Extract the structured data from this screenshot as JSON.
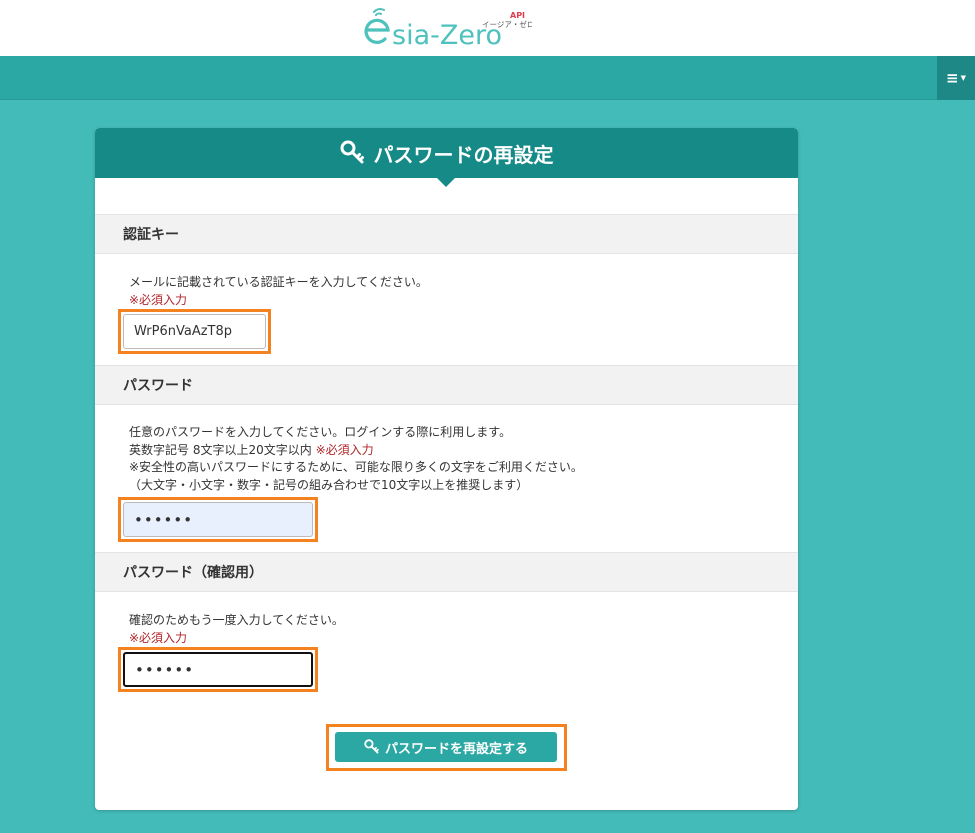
{
  "header": {
    "logo_text": "esia-Zero",
    "logo_api": "API",
    "logo_kana": "イージア・ゼロ",
    "menu_icon": "hamburger-icon"
  },
  "card": {
    "title": "パスワードの再設定",
    "title_icon": "key-icon"
  },
  "auth_key": {
    "heading": "認証キー",
    "description": "メールに記載されている認証キーを入力してください。",
    "required": "※必須入力",
    "value": "WrP6nVaAzT8p"
  },
  "password": {
    "heading": "パスワード",
    "line1": "任意のパスワードを入力してください。ログインする際に利用します。",
    "line2": "英数字記号 8文字以上20文字以内",
    "required": "※必須入力",
    "line3": "※安全性の高いパスワードにするために、可能な限り多くの文字をご利用ください。",
    "line4": "（大文字・小文字・数字・記号の組み合わせで10文字以上を推奨します）",
    "value": "••••••"
  },
  "password_confirm": {
    "heading": "パスワード（確認用）",
    "description": "確認のためもう一度入力してください。",
    "required": "※必須入力",
    "value": "••••••"
  },
  "submit": {
    "label": "パスワードを再設定する",
    "icon": "key-icon"
  },
  "colors": {
    "page_bg": "#43bbb8",
    "navbar": "#2ba7a4",
    "card_header": "#168a87",
    "highlight": "#f58220",
    "required": "#b0262a",
    "button": "#2ba8a4"
  }
}
